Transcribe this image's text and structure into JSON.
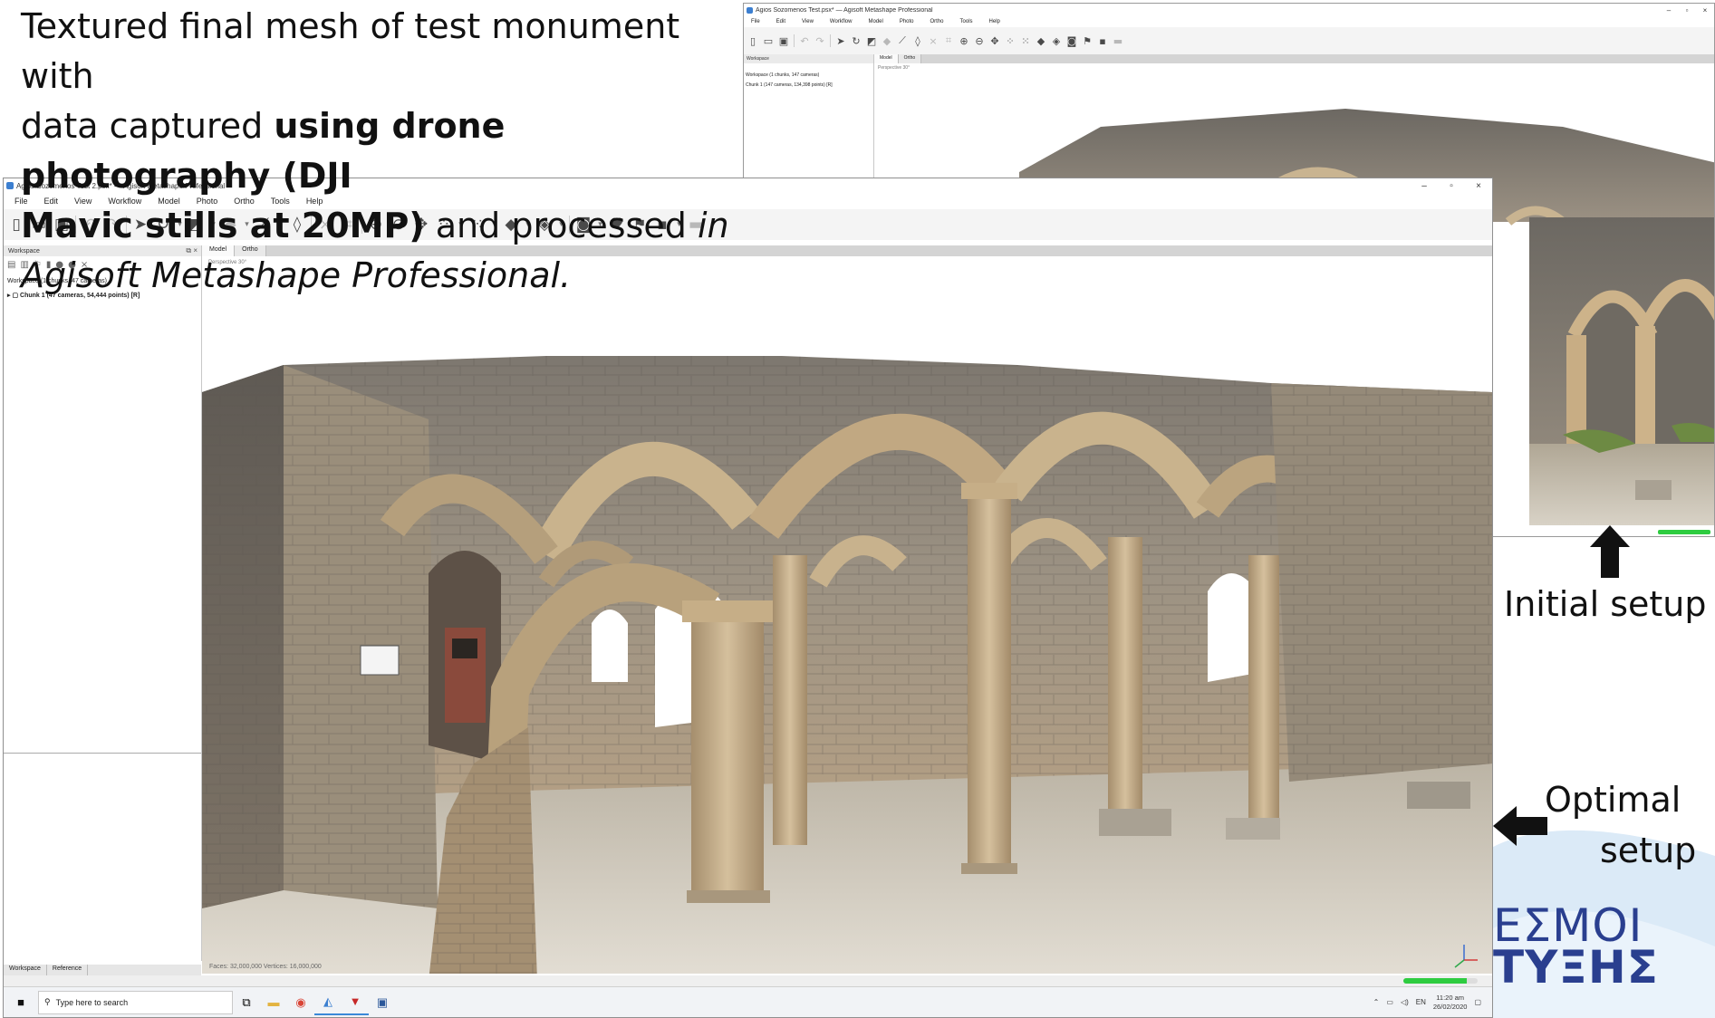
{
  "caption": {
    "line1": "Textured final mesh of test monument with",
    "line2_a": "data captured ",
    "line2_b": "using drone photography (DJI",
    "line3_b": "Mavic stills at 20MP)",
    "line3_c": " and processed ",
    "line3_d": "in",
    "line4_d": "Agisoft Metashape Professional."
  },
  "bg_window": {
    "title": "Agios Sozomenos Test.psx* — Agisoft Metashape Professional",
    "menu": [
      "File",
      "Edit",
      "View",
      "Workflow",
      "Model",
      "Photo",
      "Ortho",
      "Tools",
      "Help"
    ],
    "panel_title": "Workspace",
    "workspace_item": "Workspace (1 chunks, 147 cameras)",
    "chunk_item": "Chunk 1 (147 cameras, 134,398 points) [R]",
    "tabs": [
      "Model",
      "Ortho"
    ],
    "perspective": "Perspective 30°"
  },
  "main_window": {
    "title": "Agios Sozomenos Test 2.psx* — Agisoft Metashape Professional",
    "menu": [
      "File",
      "Edit",
      "View",
      "Workflow",
      "Model",
      "Photo",
      "Ortho",
      "Tools",
      "Help"
    ],
    "panel_title": "Workspace",
    "workspace_item": "Workspace (1 chunks, 47 cameras)",
    "chunk_item": "Chunk 1 (47 cameras, 54,444 points) [R]",
    "tabs": [
      "Model",
      "Ortho"
    ],
    "perspective": "Perspective 30°",
    "model_stats": "Faces: 32,000,000  Vertices: 16,000,000",
    "bottom_tabs": [
      "Workspace",
      "Reference"
    ],
    "progress": 0.85
  },
  "taskbar": {
    "search_placeholder": "Type here to search",
    "lang": "EN",
    "time": "11:20 am",
    "date": "26/02/2020"
  },
  "annotations": {
    "initial": "Initial setup",
    "optimal_line1": "Optimal",
    "optimal_line2": "setup"
  },
  "logo": {
    "line1": "ΕΣΜΟΙ",
    "line2": "ΤΥΞΗΣ"
  },
  "colors": {
    "accent": "#3c7fd0",
    "progress": "#2ecc40",
    "logo_blue": "#2a3f8f"
  }
}
